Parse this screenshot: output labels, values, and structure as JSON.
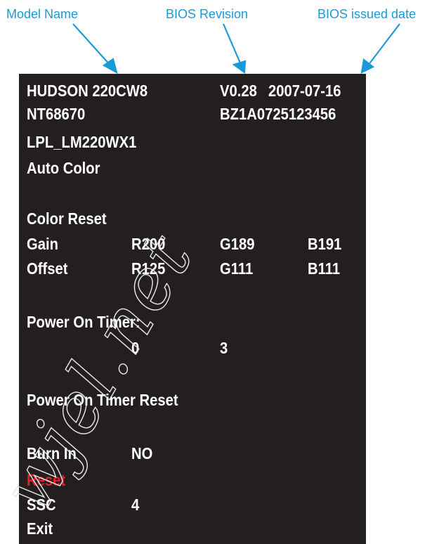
{
  "callouts": {
    "model_name": "Model Name",
    "bios_revision": "BIOS Revision",
    "bios_issued_date": "BIOS issued date"
  },
  "osd": {
    "model": "HUDSON 220CW8",
    "bios_version": "V0.28",
    "bios_date": "2007-07-16",
    "scaler": "NT68670",
    "serial": "BZ1A0725123456",
    "panel": "LPL_LM220WX1",
    "auto_color": "Auto Color",
    "color_reset": "Color Reset",
    "gain": {
      "label": "Gain",
      "r": "R200",
      "g": "G189",
      "b": "B191"
    },
    "offset": {
      "label": "Offset",
      "r": "R125",
      "g": "G111",
      "b": "B111"
    },
    "power_on_timer": {
      "label": "Power On Timer:",
      "value1": "0",
      "value2": "3"
    },
    "power_on_timer_reset": "Power On Timer Reset",
    "burn_in": {
      "label": "Burn In",
      "value": "NO"
    },
    "reset": "Reset",
    "ssc": {
      "label": "SSC",
      "value": "4"
    },
    "exit": "Exit"
  },
  "colors": {
    "callout": "#1a9ad8",
    "osd_background": "#231f20",
    "osd_text": "#ffffff",
    "highlight": "#e2232a"
  },
  "watermark": "wjel.net"
}
